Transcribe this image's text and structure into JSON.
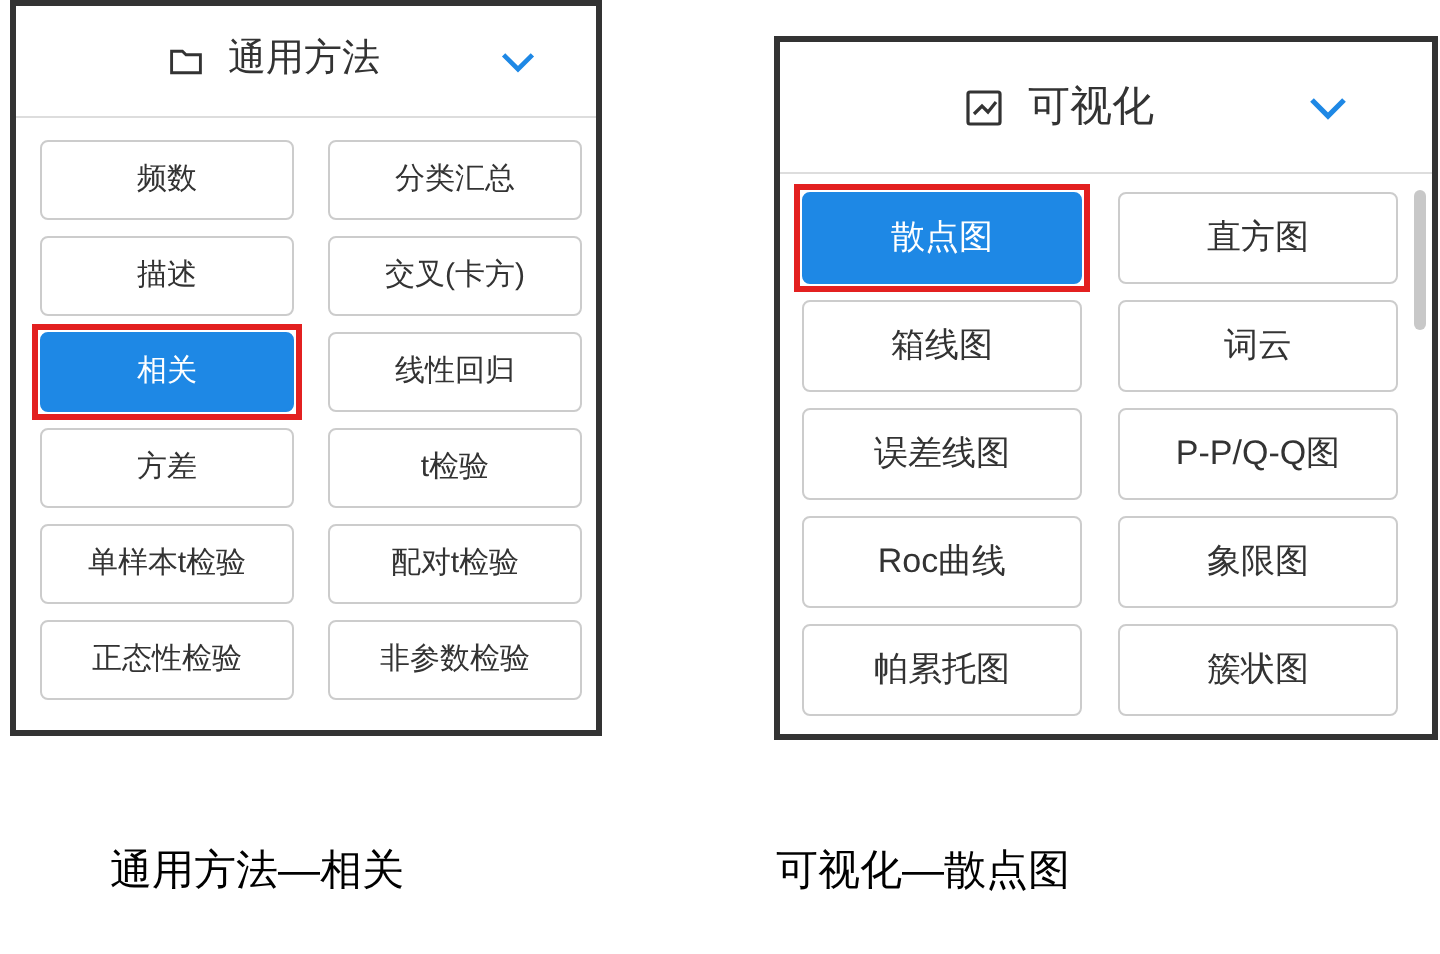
{
  "panels": [
    {
      "title": "通用方法",
      "kind": "folder",
      "caption": "通用方法—相关",
      "items": [
        {
          "label": "频数",
          "selected": false
        },
        {
          "label": "分类汇总",
          "selected": false
        },
        {
          "label": "描述",
          "selected": false
        },
        {
          "label": "交叉(卡方)",
          "selected": false
        },
        {
          "label": "相关",
          "selected": true
        },
        {
          "label": "线性回归",
          "selected": false
        },
        {
          "label": "方差",
          "selected": false
        },
        {
          "label": "t检验",
          "selected": false
        },
        {
          "label": "单样本t检验",
          "selected": false
        },
        {
          "label": "配对t检验",
          "selected": false
        },
        {
          "label": "正态性检验",
          "selected": false
        },
        {
          "label": "非参数检验",
          "selected": false
        }
      ]
    },
    {
      "title": "可视化",
      "kind": "chart",
      "caption": "可视化—散点图",
      "items": [
        {
          "label": "散点图",
          "selected": true
        },
        {
          "label": "直方图",
          "selected": false
        },
        {
          "label": "箱线图",
          "selected": false
        },
        {
          "label": "词云",
          "selected": false
        },
        {
          "label": "误差线图",
          "selected": false
        },
        {
          "label": "P-P/Q-Q图",
          "selected": false
        },
        {
          "label": "Roc曲线",
          "selected": false
        },
        {
          "label": "象限图",
          "selected": false
        },
        {
          "label": "帕累托图",
          "selected": false
        },
        {
          "label": "簇状图",
          "selected": false
        }
      ]
    }
  ]
}
